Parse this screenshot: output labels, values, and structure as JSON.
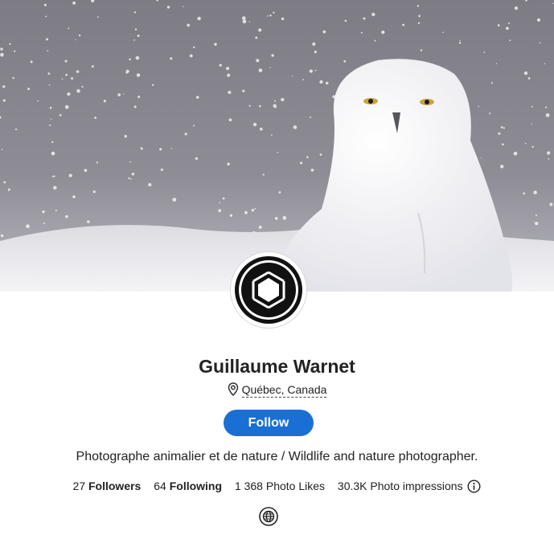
{
  "profile": {
    "name": "Guillaume Warnet",
    "location": "Québec, Canada",
    "follow_label": "Follow",
    "bio": "Photographe animalier et de nature / Wildlife and nature photographer.",
    "stats": {
      "followers_count": "27",
      "followers_label": "Followers",
      "following_count": "64",
      "following_label": "Following",
      "likes": "1 368 Photo Likes",
      "impressions": "30.3K Photo impressions"
    }
  },
  "icons": {
    "cover": "snowy-owl-cover-photo",
    "avatar": "camera-aperture-logo",
    "location": "map-pin-icon",
    "info": "info-icon",
    "website": "globe-icon"
  },
  "colors": {
    "accent": "#1a6fd4",
    "text": "#222222",
    "background": "#ffffff"
  }
}
